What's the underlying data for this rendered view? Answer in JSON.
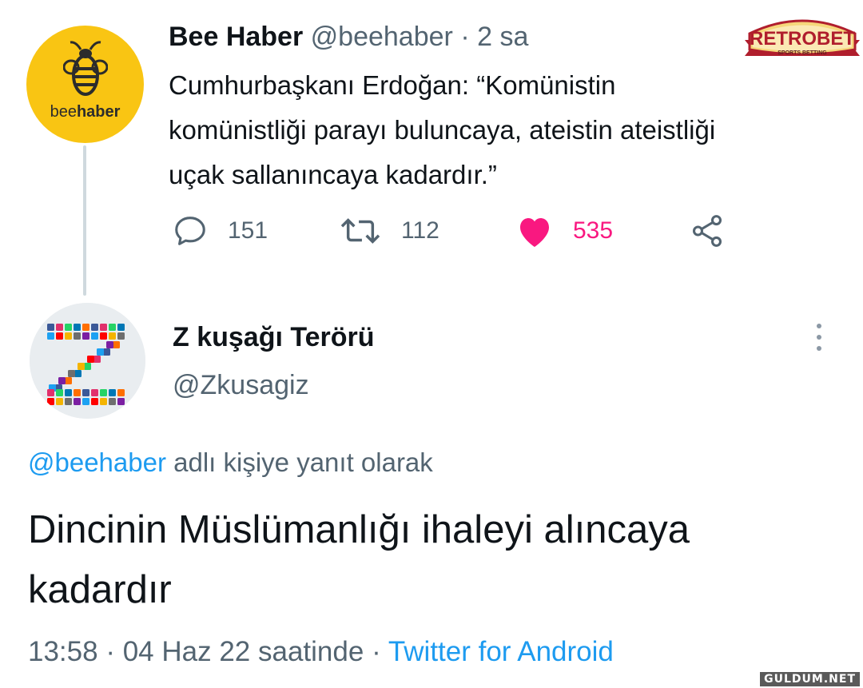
{
  "parent_tweet": {
    "author_name": "Bee Haber",
    "author_handle": "@beehaber",
    "separator": "·",
    "time_ago": "2 sa",
    "avatar_wordmark": {
      "part1": "bee",
      "part2": "haber"
    },
    "text": "Cumhurbaşkanı Erdoğan: “Komünistin komünistliği parayı buluncaya, ateistin ateistliği uçak sallanıncaya kadardır.”",
    "replies": "151",
    "retweets": "112",
    "likes": "535",
    "icons": {
      "reply": "reply-icon",
      "retweet": "retweet-icon",
      "like": "heart-icon",
      "share": "share-icon"
    },
    "like_color": "#f91880"
  },
  "ad": {
    "brand": "RETROBET",
    "tagline": "SPORTS BETTING"
  },
  "reply_tweet": {
    "author_name": "Z kuşağı Terörü",
    "author_handle": "@Zkusagiz",
    "replying_to_handle": "@beehaber",
    "replying_to_suffix": " adlı kişiye yanıt olarak",
    "text": "Dincinin Müslümanlığı ihaleyi alıncaya kadardır",
    "time": "13:58",
    "separator": "·",
    "date": "04 Haz 22 saatinde",
    "source_separator": "·",
    "source": "Twitter for Android"
  },
  "watermark": "GULDUM.NET",
  "colors": {
    "link": "#1d9bf0",
    "secondary_text": "#536471",
    "avatar_yellow": "#f9c513"
  }
}
